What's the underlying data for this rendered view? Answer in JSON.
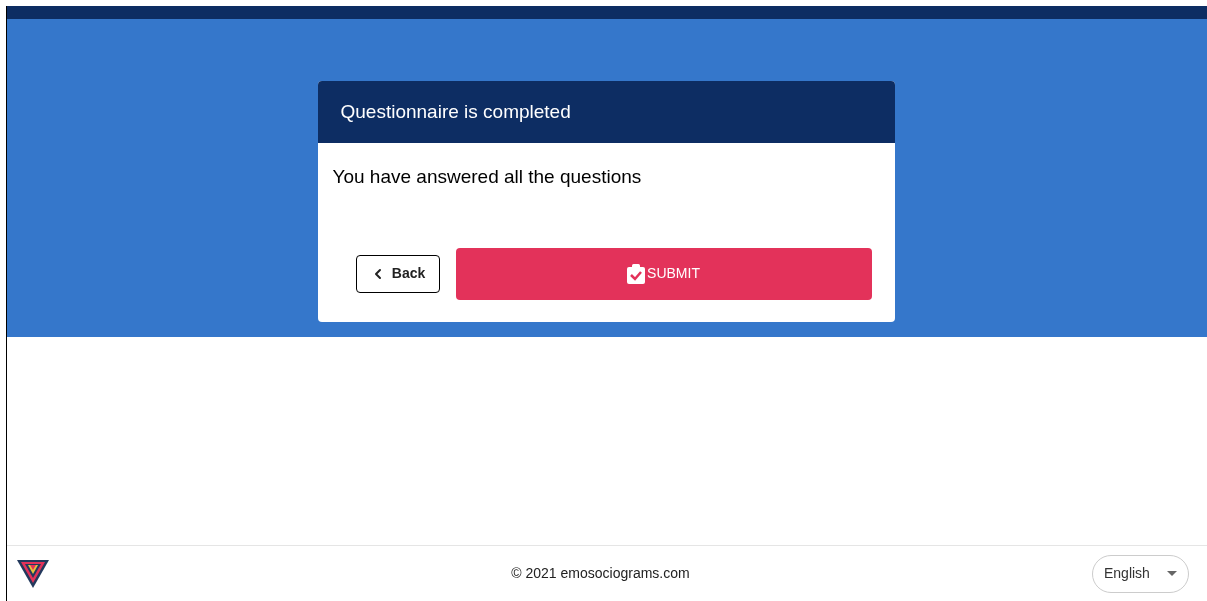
{
  "dialog": {
    "title": "Questionnaire is completed",
    "message": "You have answered all the questions",
    "back_button": "Back",
    "submit_button": "SUBMIT"
  },
  "footer": {
    "copyright": "© 2021 emosociograms.com",
    "language": "English"
  }
}
